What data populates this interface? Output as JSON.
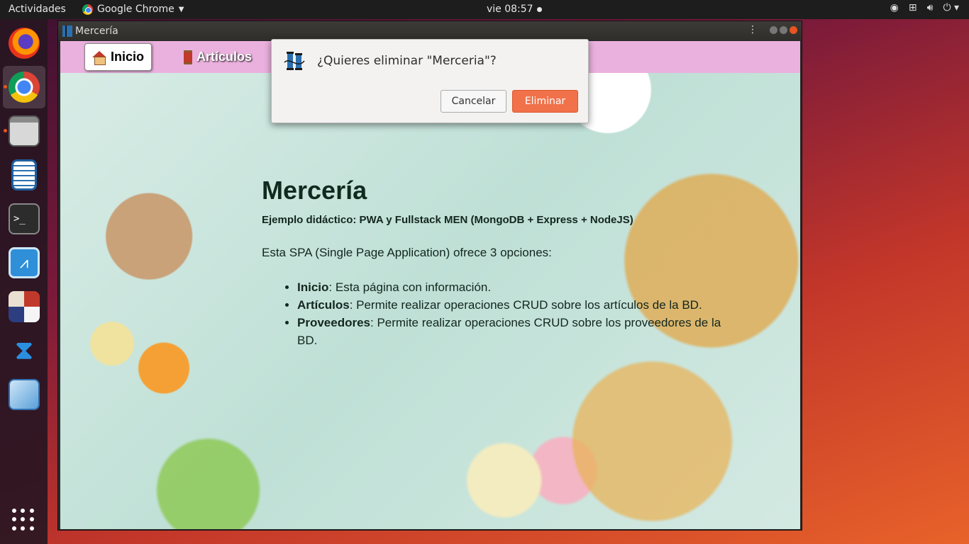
{
  "topbar": {
    "activities": "Actividades",
    "app_name": "Google Chrome",
    "clock": "vie 08:57"
  },
  "window": {
    "title": "Mercería"
  },
  "nav": {
    "items": [
      {
        "label": "Inicio",
        "icon": "house-icon",
        "active": true
      },
      {
        "label": "Artículos",
        "icon": "thread-spool-icon",
        "active": false
      }
    ],
    "background": "#ebb1de"
  },
  "article": {
    "title": "Mercería",
    "subtitle": "Ejemplo didáctico: PWA y Fullstack MEN (MongoDB + Express + NodeJS)",
    "intro": "Esta SPA (Single Page Application) ofrece 3 opciones:",
    "items": [
      {
        "term": "Inicio",
        "desc": ": Esta página con información."
      },
      {
        "term": "Artículos",
        "desc": ": Permite realizar operaciones CRUD sobre los artículos de la BD."
      },
      {
        "term": "Proveedores",
        "desc": ": Permite realizar operaciones CRUD sobre los proveedores de la BD."
      }
    ]
  },
  "dialog": {
    "message": "¿Quieres eliminar \"Merceria\"?",
    "cancel_label": "Cancelar",
    "delete_label": "Eliminar",
    "delete_color": "#f0714a"
  },
  "dock": {
    "items": [
      "firefox-icon",
      "chrome-icon",
      "files-icon",
      "writer-icon",
      "terminal-icon",
      "system-monitor-icon",
      "geometry-app-icon",
      "vscode-icon",
      "virtualbox-icon"
    ]
  }
}
